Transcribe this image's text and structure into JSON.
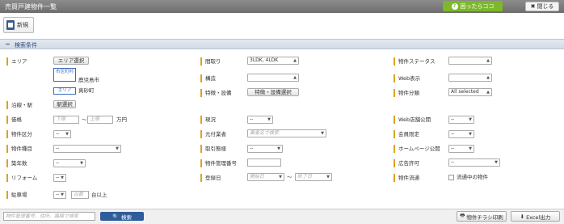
{
  "title": "売買戸建物件一覧",
  "header": {
    "help_label": "困ったらココ",
    "close_label": "閉じる"
  },
  "toolbar": {
    "new_label": "新規"
  },
  "section": {
    "toggle": "−",
    "title": "検索条件"
  },
  "form": {
    "area": {
      "label": "エリア",
      "button": "エリア選択",
      "badge_city": "市区町村",
      "city_value": "鹿児島市",
      "badge_area": "エリア",
      "area_value": "真砂町"
    },
    "line": {
      "label": "沿線・駅",
      "button": "駅選択"
    },
    "price": {
      "label": "価格",
      "min_placeholder": "下限",
      "tilde": "〜",
      "max_placeholder": "上限",
      "unit": "万円"
    },
    "property_type": {
      "label": "物件区分",
      "value": "--"
    },
    "category": {
      "label": "物件種目",
      "value": "--"
    },
    "age": {
      "label": "築年数",
      "value": "--"
    },
    "reform": {
      "label": "リフォーム",
      "value": "--"
    },
    "parking": {
      "label": "駐車場",
      "value": "--",
      "count_placeholder": "台数",
      "unit": "台以上"
    },
    "layout": {
      "label": "間取り",
      "value": "3LDK, 4LDK"
    },
    "structure": {
      "label": "構造",
      "value": ""
    },
    "features": {
      "label": "特徴・設備",
      "button": "特徴・設備選択"
    },
    "status_now": {
      "label": "現況",
      "value": "--"
    },
    "owner": {
      "label": "元付業者",
      "placeholder": "業者名で検索"
    },
    "deal_type": {
      "label": "取引態様",
      "value": "--"
    },
    "manage_no": {
      "label": "物件管理番号",
      "value": ""
    },
    "register_date": {
      "label": "登録日",
      "start_placeholder": "開始日",
      "tilde": "〜",
      "end_placeholder": "終了日"
    },
    "prop_status": {
      "label": "物件ステータス",
      "value": ""
    },
    "web_display": {
      "label": "Web表示",
      "value": ""
    },
    "prop_class": {
      "label": "物件分類",
      "value": "All selected"
    },
    "web_public": {
      "label": "Web店舗公開",
      "value": "--"
    },
    "member_only": {
      "label": "会員限定",
      "value": "--"
    },
    "homepage_public": {
      "label": "ホームページ公開",
      "value": "--"
    },
    "ad_permit": {
      "label": "広告許可",
      "value": "--"
    },
    "distribution": {
      "label": "物件流通",
      "checkbox_label": "流通中の物件"
    }
  },
  "footer": {
    "search_placeholder": "物件管理番号、住所、路線で検索",
    "search_button": "検索",
    "print_button": "物件チラシ印刷",
    "excel_button": "Excel出力"
  }
}
